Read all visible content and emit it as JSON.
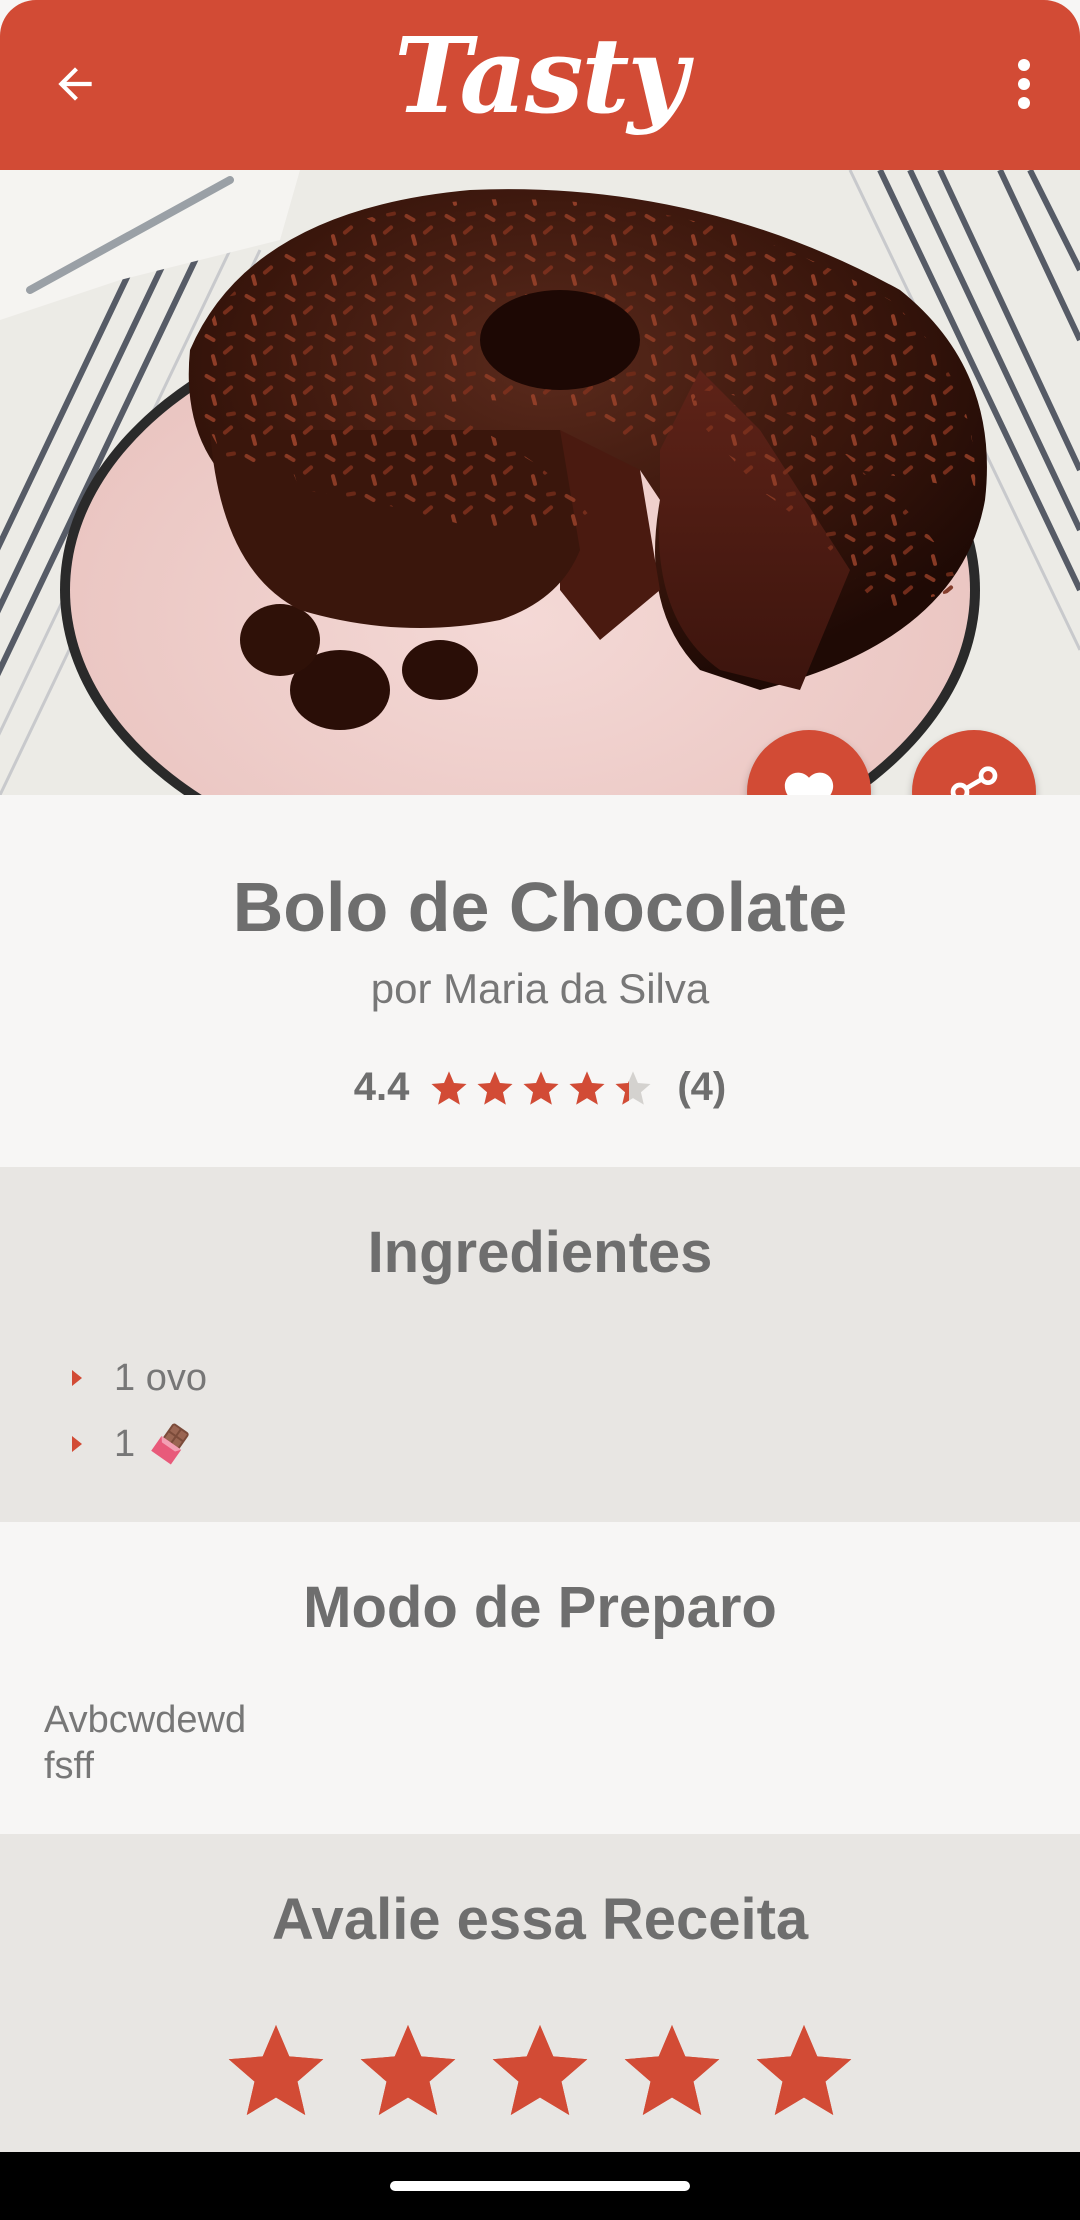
{
  "app": {
    "logo_text": "Tasty"
  },
  "header": {
    "back_icon": "arrow-left-icon",
    "menu_icon": "more-vert-icon",
    "color": "#d24b35"
  },
  "actions": {
    "favorite_icon": "heart-icon",
    "share_icon": "share-icon"
  },
  "recipe": {
    "title": "Bolo de Chocolate",
    "author": "por Maria da Silva",
    "rating_value": "4.4",
    "rating_count": "(4)",
    "rating_stars": 4.4
  },
  "ingredients": {
    "title": "Ingredientes",
    "items": [
      {
        "text": "1 ovo",
        "icon": ""
      },
      {
        "text": "1",
        "icon": "chocolate-bar-icon"
      }
    ]
  },
  "preparation": {
    "title": "Modo de Preparo",
    "text": "Avbcwdewd\nfsff"
  },
  "rate": {
    "title": "Avalie essa Receita",
    "stars": 5
  },
  "colors": {
    "accent": "#d24b35",
    "text": "#6e6e6e",
    "section_alt": "#e8e6e3",
    "background": "#f7f6f5"
  }
}
